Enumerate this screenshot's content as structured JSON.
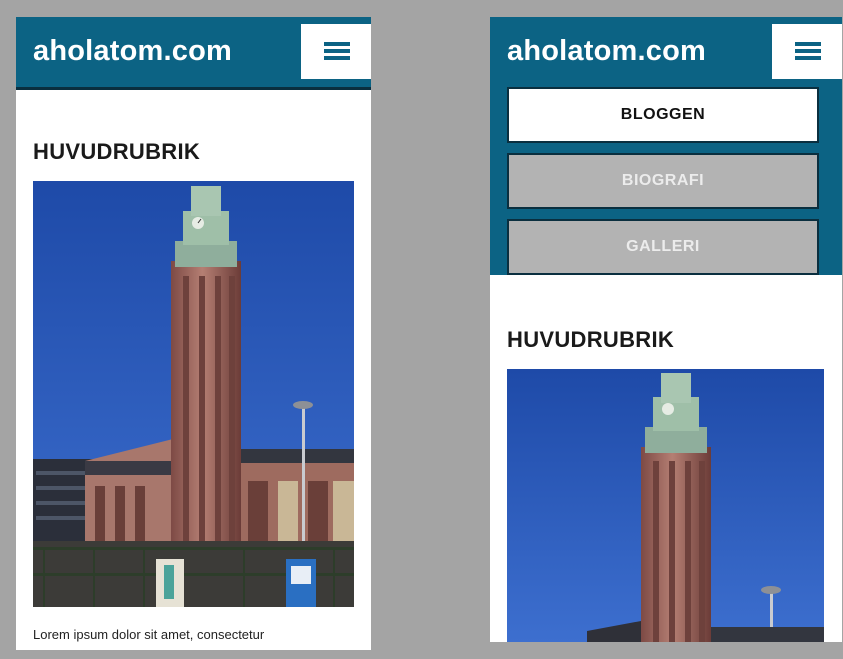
{
  "site": {
    "logo_text": "aholatom.com",
    "menu_icon": "hamburger-icon",
    "brand_color": "#0c6384"
  },
  "left_screen": {
    "heading": "HUVUDRUBRIK",
    "body_text": "Lorem ipsum dolor sit amet, consectetur"
  },
  "right_screen": {
    "nav": {
      "items": [
        {
          "label": "BLOGGEN",
          "state": "active"
        },
        {
          "label": "BIOGRAFI",
          "state": "inactive"
        },
        {
          "label": "GALLERI",
          "state": "inactive"
        }
      ]
    },
    "heading": "HUVUDRUBRIK"
  }
}
